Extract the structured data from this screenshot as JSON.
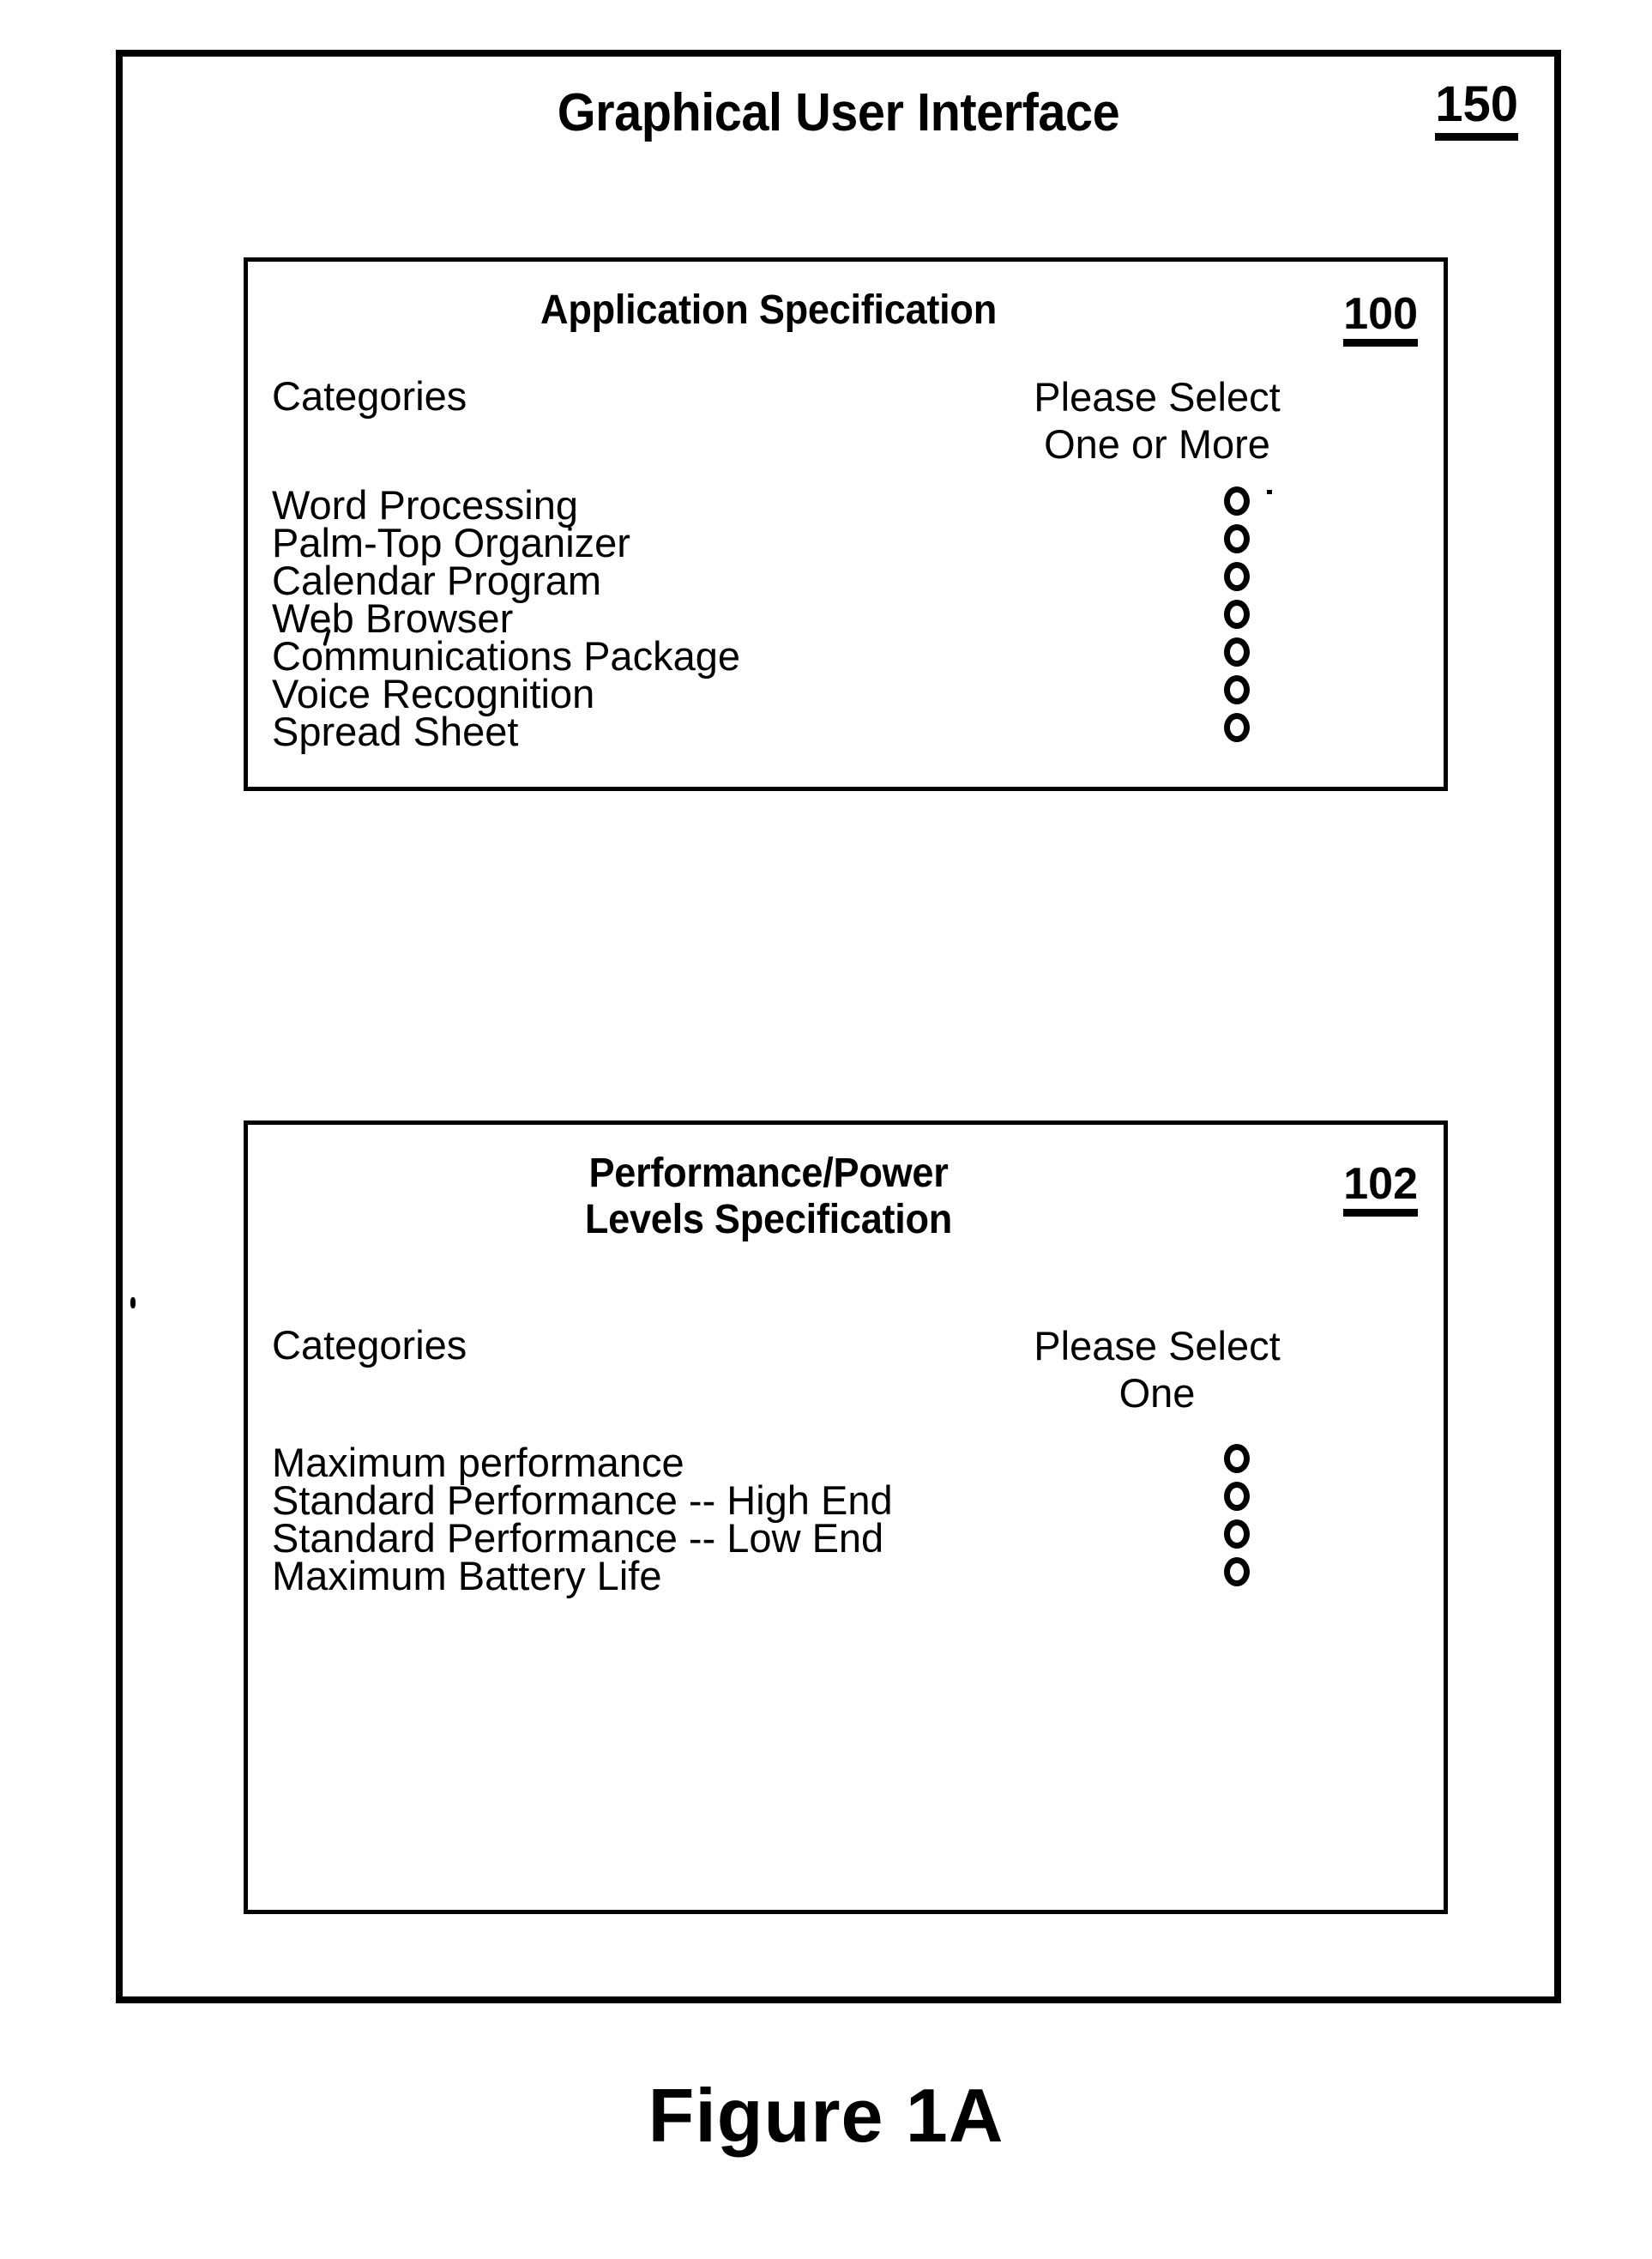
{
  "figure": {
    "caption": "Figure 1A"
  },
  "gui": {
    "title": "Graphical User Interface",
    "reference_numeral": "150"
  },
  "panels": [
    {
      "id": "application-specification",
      "title": "Application Specification",
      "reference_numeral": "100",
      "column_headers": {
        "categories": "Categories",
        "selection": "Please Select\nOne or More"
      },
      "selection_mode": "multiple",
      "options": [
        {
          "label": "Word Processing",
          "selected": false
        },
        {
          "label": "Palm-Top Organizer",
          "selected": false
        },
        {
          "label": "Calendar Program",
          "selected": false
        },
        {
          "label": "Web Browser",
          "selected": false
        },
        {
          "label": "Communications Package",
          "selected": false
        },
        {
          "label": "Voice Recognition",
          "selected": false
        },
        {
          "label": "Spread Sheet",
          "selected": false
        }
      ]
    },
    {
      "id": "performance-power-levels-specification",
      "title": "Performance/Power\nLevels Specification",
      "reference_numeral": "102",
      "column_headers": {
        "categories": "Categories",
        "selection": "Please Select\nOne"
      },
      "selection_mode": "single",
      "options": [
        {
          "label": "Maximum performance",
          "selected": false
        },
        {
          "label": "Standard Performance -- High End",
          "selected": false
        },
        {
          "label": "Standard Performance -- Low End",
          "selected": false
        },
        {
          "label": "Maximum Battery Life",
          "selected": false
        }
      ]
    }
  ],
  "colors": {
    "ink": "#000000",
    "paper": "#ffffff"
  }
}
